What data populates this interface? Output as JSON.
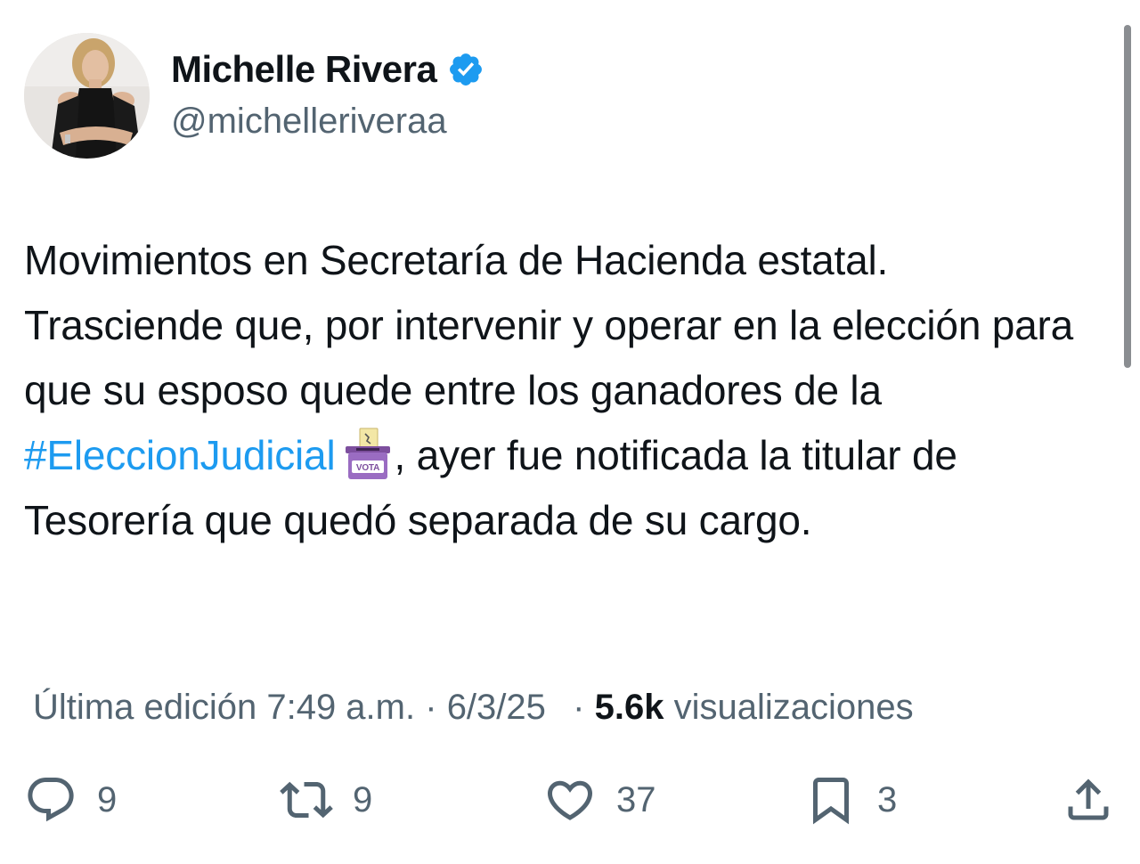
{
  "author": {
    "display_name": "Michelle Rivera",
    "handle": "@michelleriveraa",
    "verified": true,
    "avatar": "profile-photo"
  },
  "tweet": {
    "text_before": "Movimientos en Secretaría de Hacienda estatal. Trasciende que, por intervenir y operar en la elección para que su esposo quede entre los ganadores de la ",
    "hashtag": "#EleccionJudicial",
    "emoji_label": "VOTA",
    "text_after": ", ayer fue notificada la titular de Tesorería que quedó separada de su cargo."
  },
  "meta": {
    "edited_label": "Última edición",
    "time": "7:49 a.m.",
    "separator": "·",
    "date": "6/3/25",
    "views_count": "5.6k",
    "views_label": "visualizaciones"
  },
  "actions": {
    "replies": "9",
    "reposts": "9",
    "likes": "37",
    "bookmarks": "3"
  },
  "colors": {
    "accent": "#1d9bf0",
    "text": "#0f1419",
    "secondary": "#536471"
  }
}
